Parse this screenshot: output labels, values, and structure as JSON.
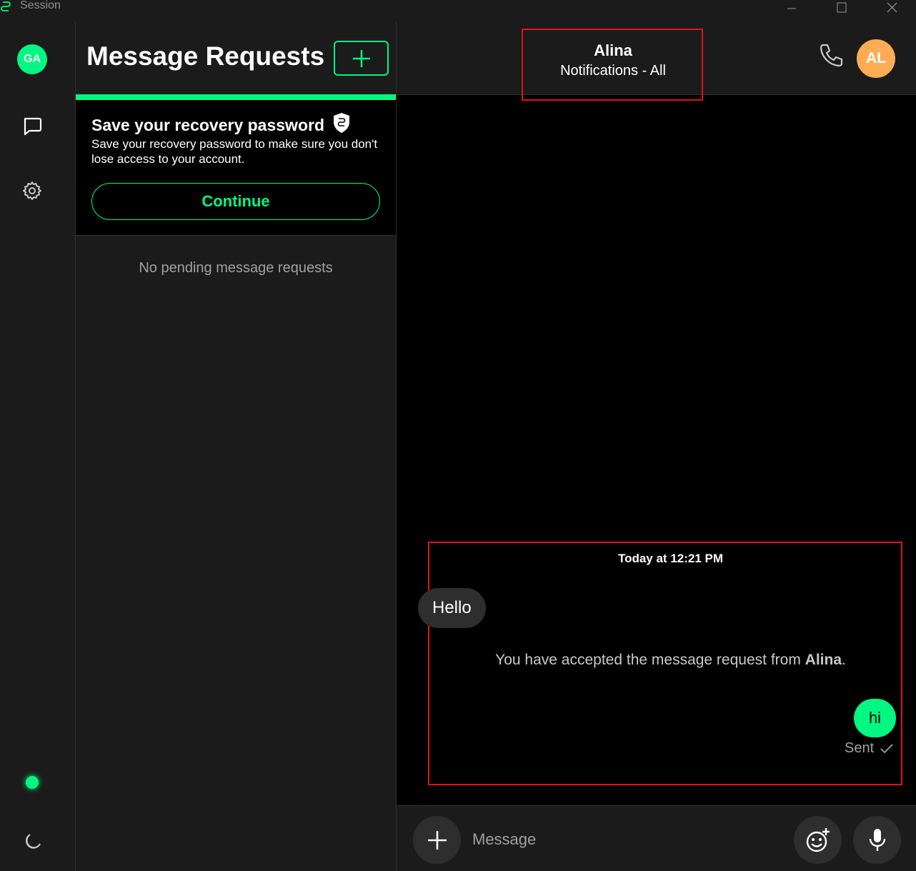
{
  "window": {
    "title": "Session",
    "icons": [
      "session-logo-icon",
      "minimize-icon",
      "maximize-icon",
      "close-icon"
    ]
  },
  "rail": {
    "avatar_initials": "GA",
    "icons": [
      "messages-icon",
      "settings-gear-icon",
      "online-status-indicator",
      "moon-theme-icon"
    ]
  },
  "panel": {
    "title": "Message Requests",
    "recovery": {
      "title": "Save your recovery password",
      "description": "Save your recovery password to make sure you don't lose access to your account.",
      "button_label": "Continue"
    },
    "empty_text": "No pending message requests"
  },
  "conversation": {
    "header": {
      "name": "Alina",
      "subtitle": "Notifications - All",
      "avatar_initials": "AL"
    },
    "timestamp": "Today at 12:21 PM",
    "messages": [
      {
        "direction": "incoming",
        "text": "Hello"
      },
      {
        "direction": "outgoing",
        "text": "hi",
        "status": "Sent"
      }
    ],
    "system_message": {
      "prefix": "You have accepted the message request from ",
      "name": "Alina",
      "suffix": "."
    },
    "composer": {
      "placeholder": "Message"
    }
  },
  "colors": {
    "accent": "#00f782",
    "avatar_al": "#ffac55",
    "highlight_box": "#e0121b",
    "panel_bg": "#1b1b1b",
    "chat_bg": "#000000"
  }
}
